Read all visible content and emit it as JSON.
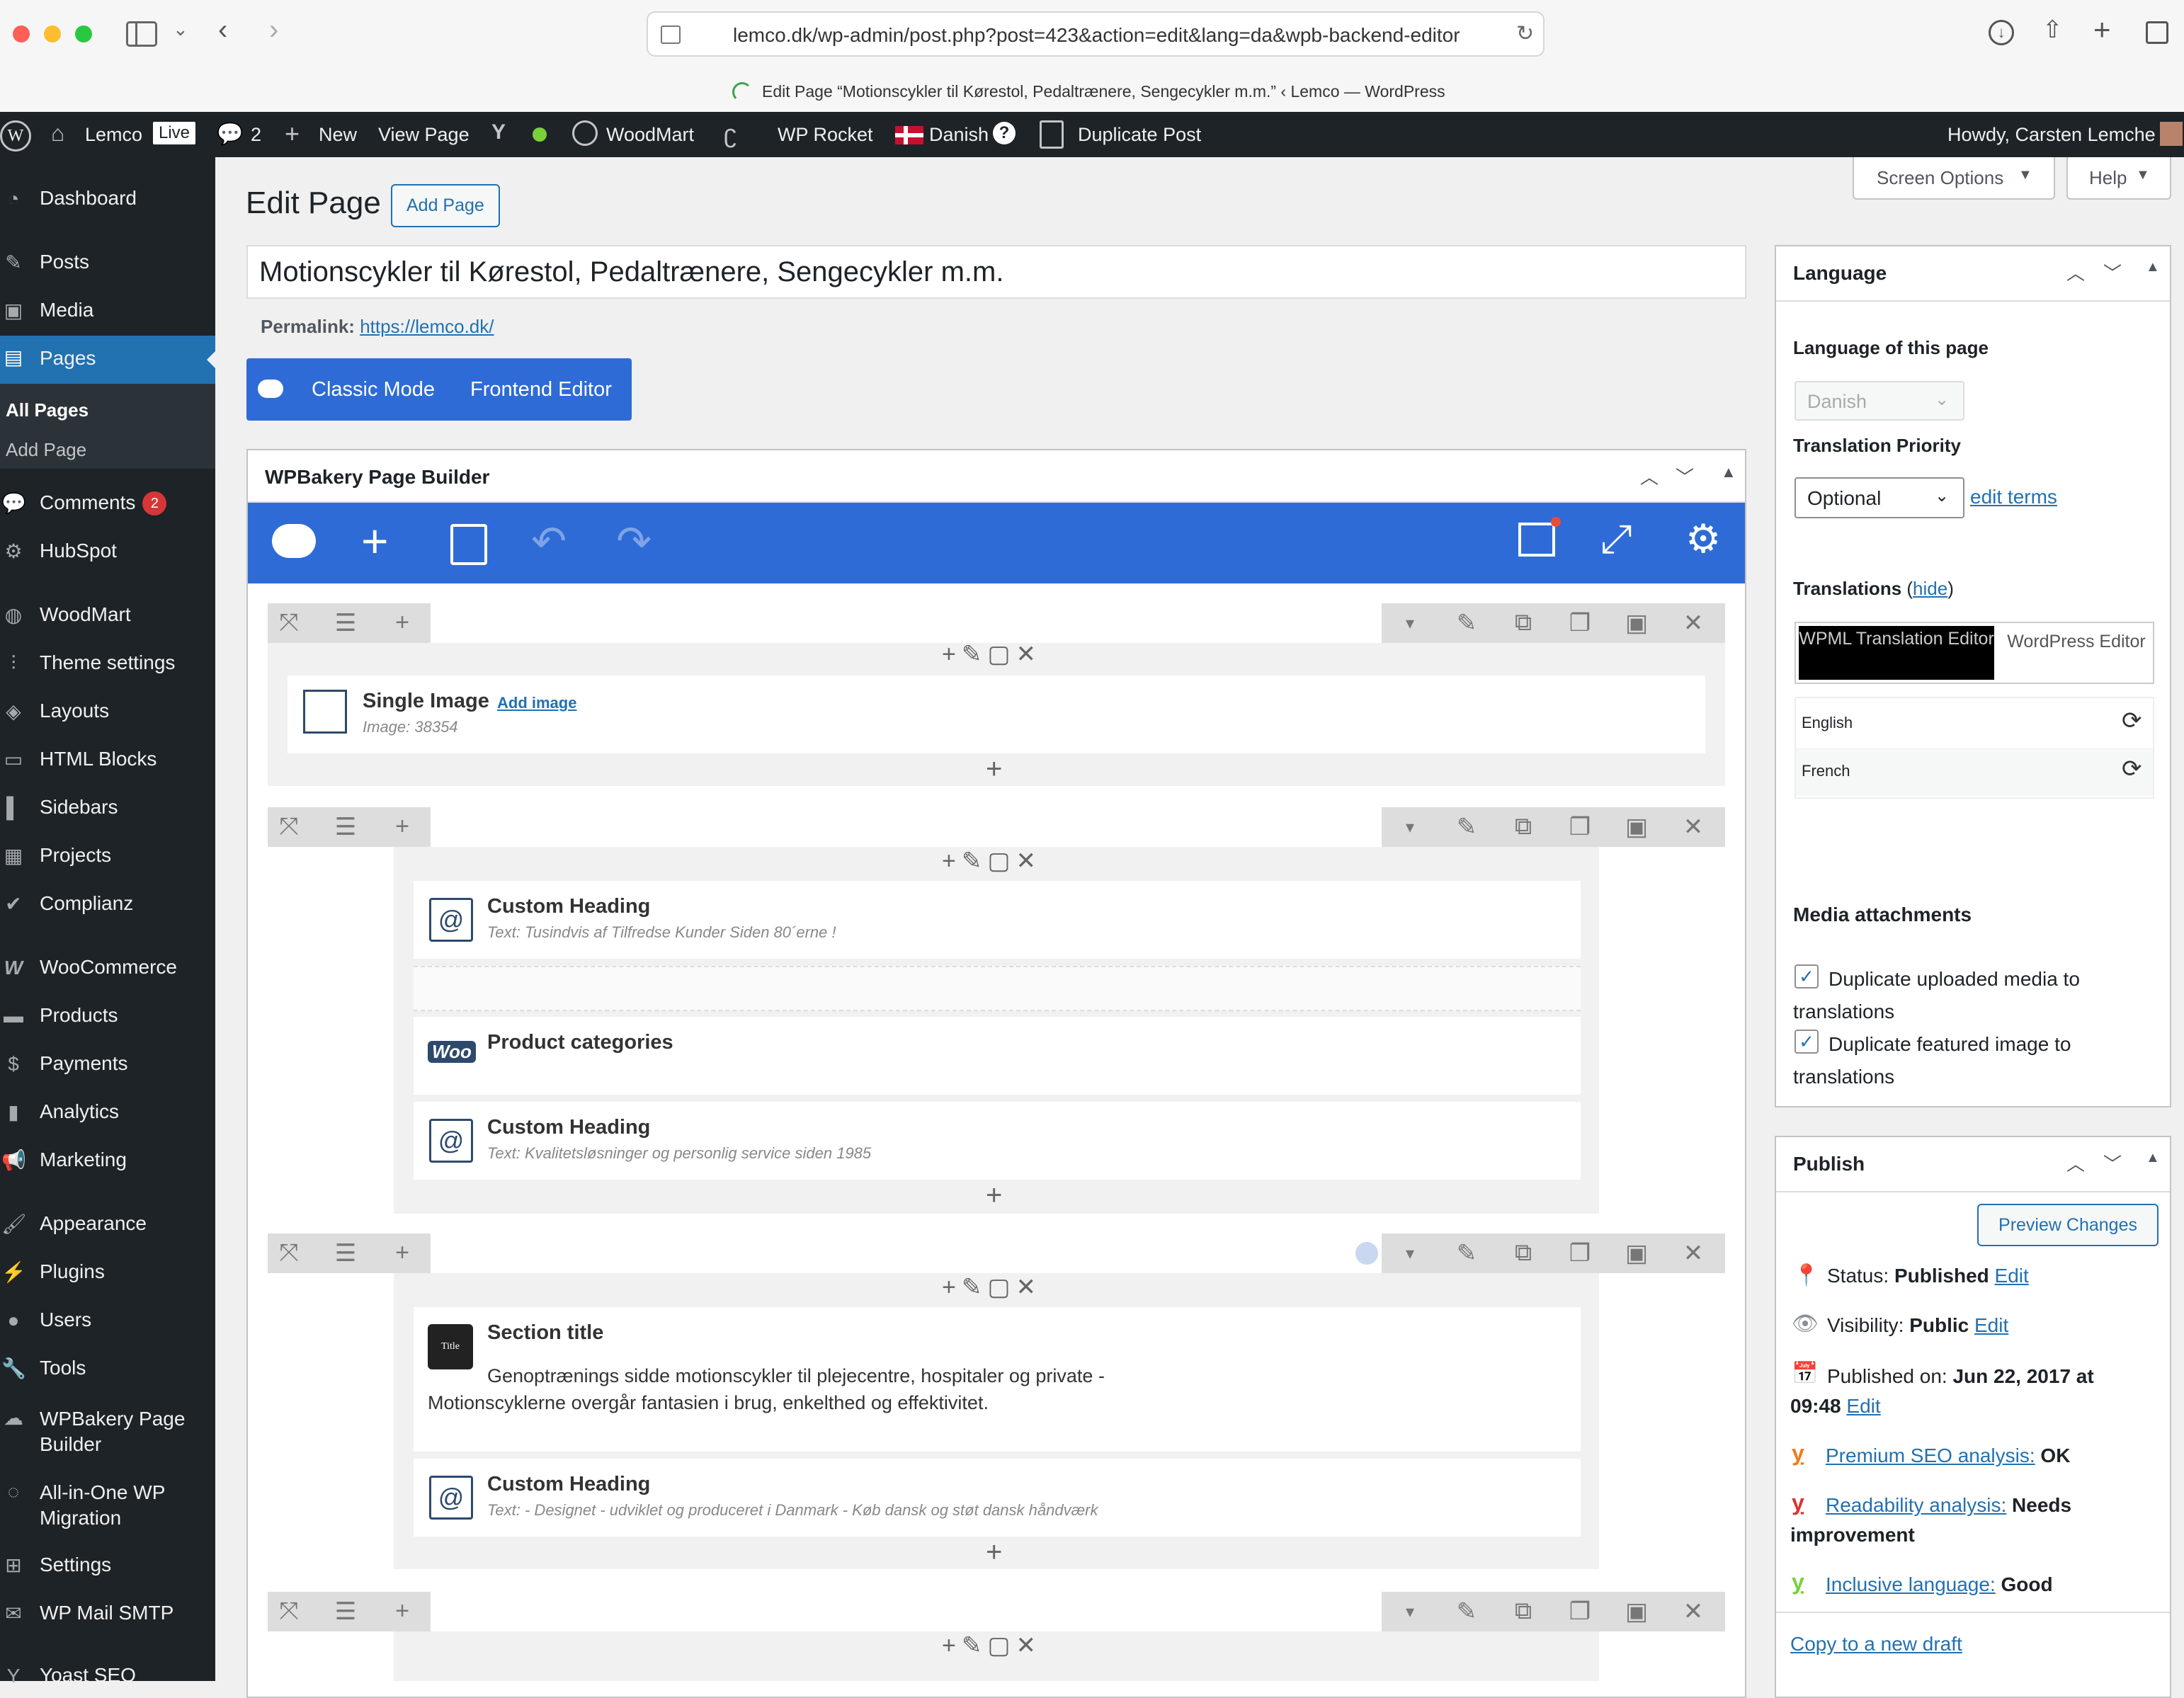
{
  "browser": {
    "url": "lemco.dk/wp-admin/post.php?post=423&action=edit&lang=da&wpb-backend-editor",
    "tab_title": "Edit Page “Motionscykler til Kørestol, Pedaltrænere, Sengecykler m.m.” ‹ Lemco — WordPress"
  },
  "adminbar": {
    "site": "Lemco",
    "live": "Live",
    "comments": "2",
    "new": "New",
    "view_page": "View Page",
    "woodmart": "WoodMart",
    "wp_rocket": "WP Rocket",
    "language": "Danish",
    "help": "?",
    "duplicate": "Duplicate Post",
    "howdy": "Howdy, Carsten Lemche"
  },
  "sidebar": {
    "items": [
      {
        "label": "Dashboard",
        "icon": "dashboard-icon"
      },
      {
        "label": "Posts",
        "icon": "pin-icon"
      },
      {
        "label": "Media",
        "icon": "media-icon"
      },
      {
        "label": "Pages",
        "icon": "pages-icon"
      },
      {
        "label": "Comments",
        "icon": "comment-icon"
      },
      {
        "label": "HubSpot",
        "icon": "hubspot-icon"
      },
      {
        "label": "WoodMart",
        "icon": "woodmart-icon"
      },
      {
        "label": "Theme settings",
        "icon": "sliders-icon"
      },
      {
        "label": "Layouts",
        "icon": "layers-icon"
      },
      {
        "label": "HTML Blocks",
        "icon": "code-icon"
      },
      {
        "label": "Sidebars",
        "icon": "sidebar-icon"
      },
      {
        "label": "Projects",
        "icon": "briefcase-icon"
      },
      {
        "label": "Complianz",
        "icon": "check-icon"
      },
      {
        "label": "WooCommerce",
        "icon": "woo-icon"
      },
      {
        "label": "Products",
        "icon": "archive-icon"
      },
      {
        "label": "Payments",
        "icon": "dollar-icon"
      },
      {
        "label": "Analytics",
        "icon": "chart-icon"
      },
      {
        "label": "Marketing",
        "icon": "megaphone-icon"
      },
      {
        "label": "Appearance",
        "icon": "brush-icon"
      },
      {
        "label": "Plugins",
        "icon": "plug-icon"
      },
      {
        "label": "Users",
        "icon": "user-icon"
      },
      {
        "label": "Tools",
        "icon": "wrench-icon"
      },
      {
        "label": "WPBakery Page Builder",
        "icon": "cloud-icon"
      },
      {
        "label": "All-in-One WP Migration",
        "icon": "migration-icon"
      },
      {
        "label": "Settings",
        "icon": "settings-icon"
      },
      {
        "label": "WP Mail SMTP",
        "icon": "mail-icon"
      },
      {
        "label": "Yoast SEO",
        "icon": "yoast-icon"
      }
    ],
    "sub_all_pages": "All Pages",
    "sub_add_page": "Add Page",
    "comments_badge": "2"
  },
  "main": {
    "heading": "Edit Page",
    "add_page": "Add Page",
    "title": "Motionscykler til Kørestol, Pedaltrænere, Sengecykler m.m.",
    "permalink_label": "Permalink:",
    "permalink_url": "https://lemco.dk/",
    "classic_mode": "Classic Mode",
    "frontend_editor": "Frontend Editor",
    "screen_options": "Screen Options",
    "help": "Help"
  },
  "wpb": {
    "title": "WPBakery Page Builder",
    "elements": {
      "single_image_title": "Single Image",
      "add_image": "Add image",
      "single_image_sub": "Image: 38354",
      "ch1_title": "Custom Heading",
      "ch1_sub": "Text: Tusindvis af Tilfredse Kunder Siden 80´erne !",
      "product_categories": "Product categories",
      "woo_logo": "Woo",
      "ch2_title": "Custom Heading",
      "ch2_sub": "Text: Kvalitetsløsninger og personlig service siden 1985",
      "section_title": "Section title",
      "section_badge": "Title",
      "section_text1": "Genoptrænings sidde motionscykler til plejecentre, hospitaler og private -",
      "section_text2": "Motionscyklerne overgår fantasien i brug, enkelthed og effektivitet.",
      "ch3_title": "Custom Heading",
      "ch3_sub": "Text: - Designet - udviklet og produceret i Danmark - Køb dansk og støt dansk håndværk"
    }
  },
  "language_box": {
    "title": "Language",
    "lang_label": "Language of this page",
    "lang_value": "Danish",
    "priority_label": "Translation Priority",
    "priority_value": "Optional",
    "edit_terms": "edit terms",
    "translations_label": "Translations",
    "hide": "hide",
    "wpml_editor": "WPML Translation Editor",
    "wp_editor": "WordPress Editor",
    "translations": [
      "English",
      "French"
    ],
    "media_title": "Media attachments",
    "dup_media": "Duplicate uploaded media to translations",
    "dup_featured": "Duplicate featured image to translations"
  },
  "publish_box": {
    "title": "Publish",
    "preview": "Preview Changes",
    "status_label": "Status:",
    "status_value": "Published",
    "visibility_label": "Visibility:",
    "visibility_value": "Public",
    "published_label": "Published on:",
    "published_value": "Jun 22, 2017 at",
    "published_time": "09:48",
    "edit": "Edit",
    "seo_link": "Premium SEO analysis:",
    "seo_value": "OK",
    "read_link": "Readability analysis:",
    "read_value": "Needs",
    "read_value2": "improvement",
    "incl_link": "Inclusive language:",
    "incl_value": "Good",
    "copy_draft": "Copy to a new draft"
  },
  "colors": {
    "admin_dark": "#1d2327",
    "wp_blue": "#2271b1",
    "wpb_blue": "#2e6bd6",
    "badge_red": "#d63638"
  }
}
